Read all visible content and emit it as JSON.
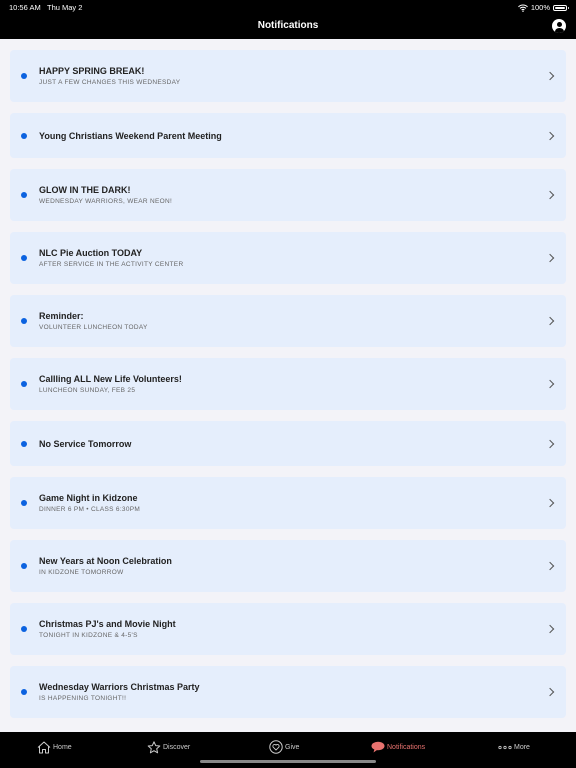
{
  "status": {
    "time": "10:56 AM",
    "date": "Thu May 2",
    "battery": "100%",
    "icons": [
      "wifi-icon",
      "battery-icon"
    ]
  },
  "nav": {
    "title": "Notifications",
    "profile_icon": "user-circle-icon"
  },
  "notifications": [
    {
      "title": "HAPPY SPRING BREAK!",
      "subtitle": "JUST A FEW CHANGES THIS WEDNESDAY"
    },
    {
      "title": "Young Christians Weekend Parent Meeting",
      "subtitle": ""
    },
    {
      "title": "GLOW IN THE DARK!",
      "subtitle": "WEDNESDAY WARRIORS, WEAR NEON!"
    },
    {
      "title": "NLC Pie Auction TODAY",
      "subtitle": "AFTER SERVICE IN THE ACTIVITY CENTER"
    },
    {
      "title": "Reminder:",
      "subtitle": "VOLUNTEER LUNCHEON TODAY"
    },
    {
      "title": "Callling ALL New Life Volunteers!",
      "subtitle": "LUNCHEON SUNDAY, FEB 25"
    },
    {
      "title": "No Service Tomorrow",
      "subtitle": ""
    },
    {
      "title": "Game Night in Kidzone",
      "subtitle": "DINNER 6 PM • CLASS 6:30PM"
    },
    {
      "title": "New Years at Noon Celebration",
      "subtitle": "IN KIDZONE TOMORROW"
    },
    {
      "title": "Christmas PJ's and Movie Night",
      "subtitle": "TONIGHT IN KIDZONE & 4-5'S"
    },
    {
      "title": "Wednesday Warriors Christmas Party",
      "subtitle": "IS HAPPENING TONIGHT!!"
    }
  ],
  "tabs": [
    {
      "label": "Home",
      "icon": "home-icon",
      "active": false
    },
    {
      "label": "Discover",
      "icon": "star-icon",
      "active": false
    },
    {
      "label": "Give",
      "icon": "heart-icon",
      "active": false
    },
    {
      "label": "Notifications",
      "icon": "speech-bubble-icon",
      "active": true
    },
    {
      "label": "More",
      "icon": "more-dots-icon",
      "active": false
    }
  ],
  "colors": {
    "unread_dot": "#0b62e0",
    "card_bg": "#e5eefc",
    "active_tab": "#e8726f",
    "bar_bg": "#000000"
  }
}
